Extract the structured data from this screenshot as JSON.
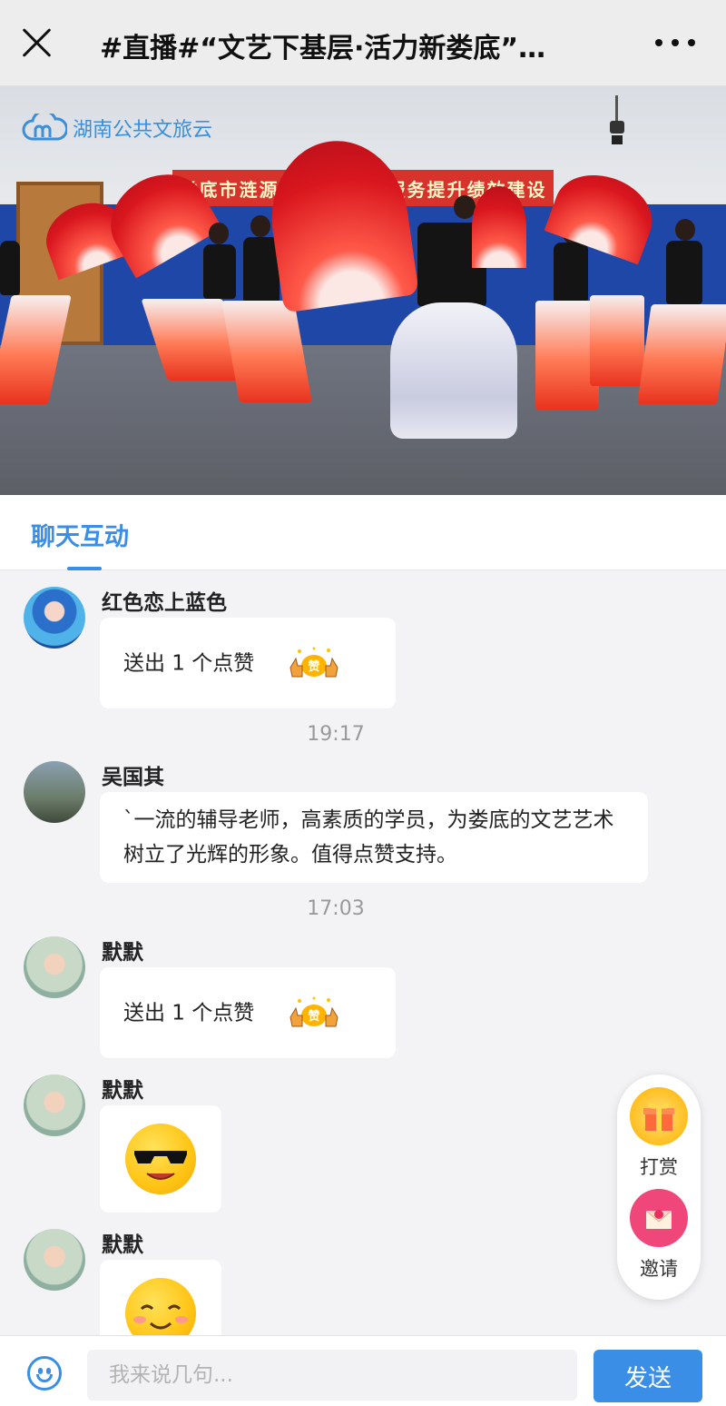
{
  "header": {
    "title": "#直播#“文艺下基层·活力新娄底”…",
    "close_icon": "close-icon",
    "more_icon": "more-icon"
  },
  "video": {
    "brand": "湖南公共文旅云",
    "banner_text": "娄底市涟源市 艺术普及服务提升绩效建设"
  },
  "tabs": [
    {
      "label": "聊天互动",
      "active": true
    }
  ],
  "messages": [
    {
      "name": "红色恋上蓝色",
      "type": "like",
      "text": "送出 1 个点赞"
    },
    {
      "timestamp": "19:17"
    },
    {
      "name": "吴国其",
      "type": "text",
      "text": "`一流的辅导老师，高素质的学员，为娄底的文艺艺术树立了光辉的形象。值得点赞支持。"
    },
    {
      "timestamp": "17:03"
    },
    {
      "name": "默默",
      "type": "like",
      "text": "送出 1 个点赞"
    },
    {
      "name": "默默",
      "type": "emoji",
      "emoji": "cool-sunglasses-emoji"
    },
    {
      "name": "默默",
      "type": "emoji",
      "emoji": "smile-emoji"
    }
  ],
  "actions": {
    "reward_label": "打赏",
    "invite_label": "邀请"
  },
  "input": {
    "placeholder": "我来说几句...",
    "send_label": "发送"
  },
  "colors": {
    "accent": "#3a8ee6",
    "header_bg": "#ededed",
    "chat_bg": "#f3f3f5"
  }
}
